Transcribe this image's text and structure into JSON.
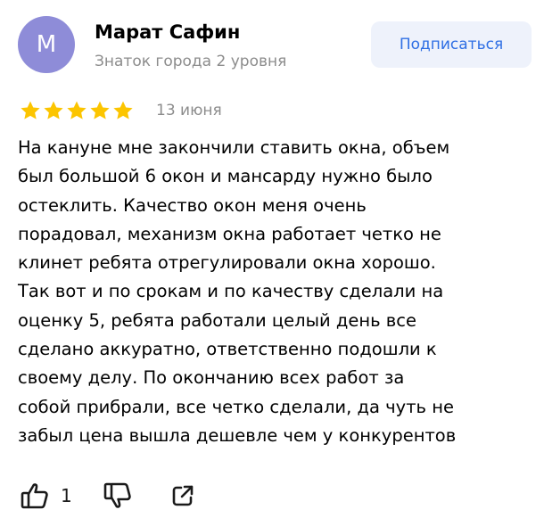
{
  "colors": {
    "avatar_bg": "#8e8cd8",
    "star": "#fcc500",
    "subscribe_bg": "#eef2fb",
    "subscribe_text": "#2f6fe4",
    "muted_text": "#8c8c8c"
  },
  "author": {
    "initial": "М",
    "name": "Марат Сафин",
    "level": "Знаток города 2 уровня"
  },
  "subscribe_label": "Подписаться",
  "review": {
    "rating": 5,
    "rating_max": 5,
    "date": "13 июня",
    "text": "На кануне мне закончили ставить окна, объем\nбыл большой 6 окон и мансарду нужно было\nостеклить. Качество окон меня очень\nпорадовал, механизм окна работает четко не\nклинет ребята отрегулировали окна хорошо.\nТак вот и по срокам и по качеству сделали на\nоценку 5, ребята работали целый день все\nсделано аккуратно, ответственно подошли к\nсвоему делу. По окончанию всех работ за\nсобой прибрали, все четко сделали, да чуть не\nзабыл цена вышла дешевле чем у конкурентов"
  },
  "actions": {
    "like_count": "1",
    "icons": [
      "thumbs-up-icon",
      "thumbs-down-icon",
      "share-icon"
    ]
  }
}
